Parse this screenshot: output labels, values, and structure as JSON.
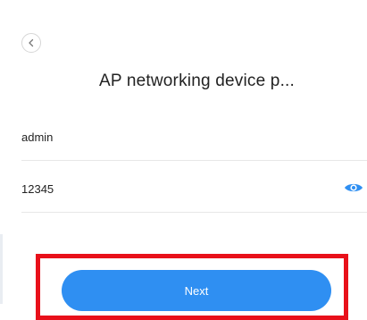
{
  "header": {
    "title": "AP networking device p..."
  },
  "form": {
    "username_value": "admin",
    "password_value": "12345"
  },
  "actions": {
    "next_label": "Next"
  },
  "colors": {
    "accent": "#2f8ff2",
    "highlight": "#e8101a"
  },
  "icons": {
    "back": "chevron-left-icon",
    "password_visibility": "eye-icon"
  }
}
